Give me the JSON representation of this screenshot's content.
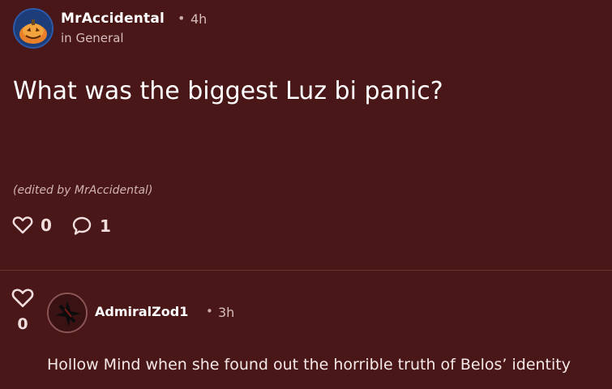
{
  "post": {
    "author": "MrAccidental",
    "separator": "•",
    "time": "4h",
    "community": "in General",
    "title": "What was the biggest Luz bi panic?",
    "edited_note": "(edited by MrAccidental)",
    "likes": "0",
    "comments": "1",
    "avatar_icon": "jack-o-lantern-avatar"
  },
  "comment": {
    "author": "AdmiralZod1",
    "separator": "•",
    "time": "3h",
    "likes": "0",
    "body": "Hollow Mind when she found out the horrible truth of Belos’ identity",
    "avatar_icon": "dark-emblem-avatar"
  },
  "icons": {
    "like": "heart-outline-icon",
    "comment": "speech-bubble-icon"
  },
  "colors": {
    "background": "#4a1718",
    "text": "#ffffff",
    "muted": "#d7bcbc",
    "divider": "#6b3334"
  }
}
